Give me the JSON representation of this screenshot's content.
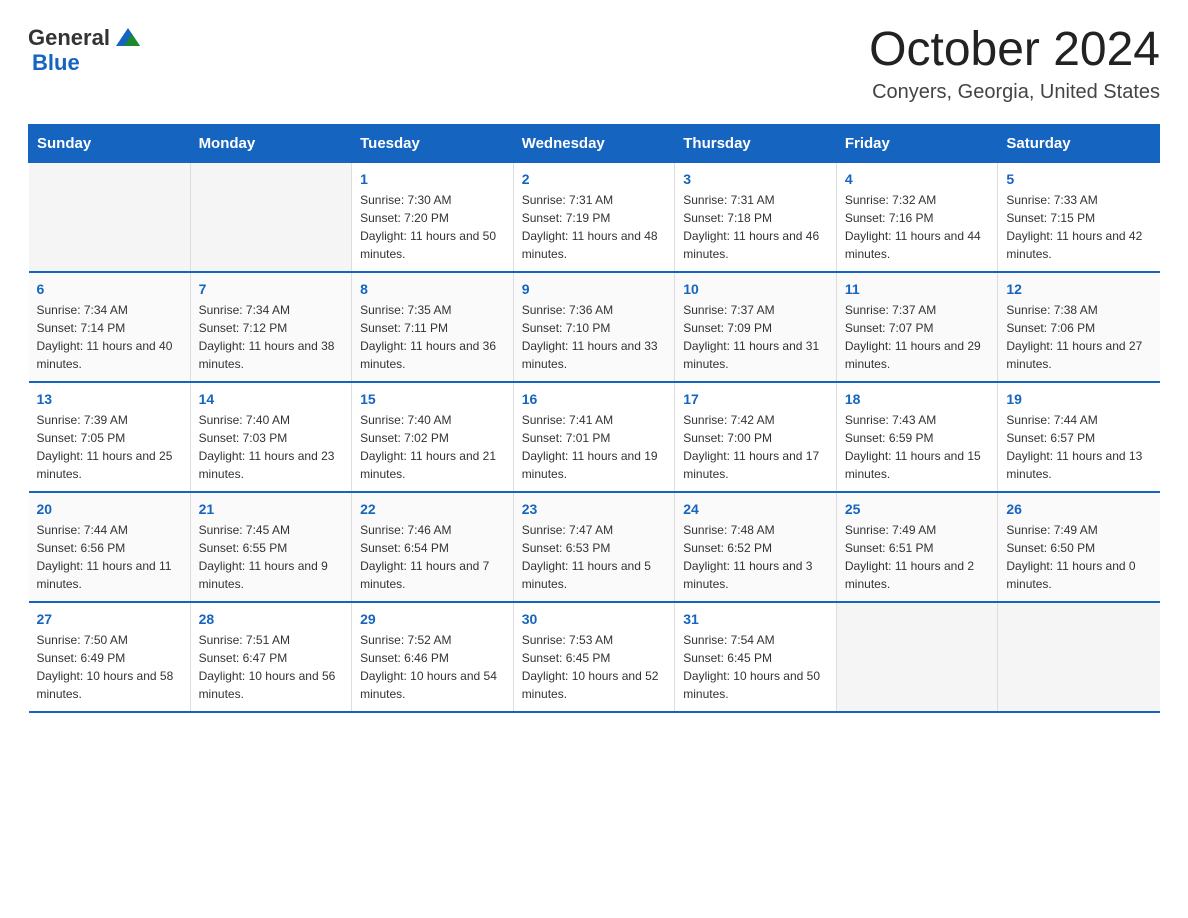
{
  "header": {
    "logo_general": "General",
    "logo_blue": "Blue",
    "title": "October 2024",
    "subtitle": "Conyers, Georgia, United States"
  },
  "days_of_week": [
    "Sunday",
    "Monday",
    "Tuesday",
    "Wednesday",
    "Thursday",
    "Friday",
    "Saturday"
  ],
  "weeks": [
    [
      {
        "day": "",
        "empty": true
      },
      {
        "day": "",
        "empty": true
      },
      {
        "day": "1",
        "sunrise": "7:30 AM",
        "sunset": "7:20 PM",
        "daylight": "11 hours and 50 minutes."
      },
      {
        "day": "2",
        "sunrise": "7:31 AM",
        "sunset": "7:19 PM",
        "daylight": "11 hours and 48 minutes."
      },
      {
        "day": "3",
        "sunrise": "7:31 AM",
        "sunset": "7:18 PM",
        "daylight": "11 hours and 46 minutes."
      },
      {
        "day": "4",
        "sunrise": "7:32 AM",
        "sunset": "7:16 PM",
        "daylight": "11 hours and 44 minutes."
      },
      {
        "day": "5",
        "sunrise": "7:33 AM",
        "sunset": "7:15 PM",
        "daylight": "11 hours and 42 minutes."
      }
    ],
    [
      {
        "day": "6",
        "sunrise": "7:34 AM",
        "sunset": "7:14 PM",
        "daylight": "11 hours and 40 minutes."
      },
      {
        "day": "7",
        "sunrise": "7:34 AM",
        "sunset": "7:12 PM",
        "daylight": "11 hours and 38 minutes."
      },
      {
        "day": "8",
        "sunrise": "7:35 AM",
        "sunset": "7:11 PM",
        "daylight": "11 hours and 36 minutes."
      },
      {
        "day": "9",
        "sunrise": "7:36 AM",
        "sunset": "7:10 PM",
        "daylight": "11 hours and 33 minutes."
      },
      {
        "day": "10",
        "sunrise": "7:37 AM",
        "sunset": "7:09 PM",
        "daylight": "11 hours and 31 minutes."
      },
      {
        "day": "11",
        "sunrise": "7:37 AM",
        "sunset": "7:07 PM",
        "daylight": "11 hours and 29 minutes."
      },
      {
        "day": "12",
        "sunrise": "7:38 AM",
        "sunset": "7:06 PM",
        "daylight": "11 hours and 27 minutes."
      }
    ],
    [
      {
        "day": "13",
        "sunrise": "7:39 AM",
        "sunset": "7:05 PM",
        "daylight": "11 hours and 25 minutes."
      },
      {
        "day": "14",
        "sunrise": "7:40 AM",
        "sunset": "7:03 PM",
        "daylight": "11 hours and 23 minutes."
      },
      {
        "day": "15",
        "sunrise": "7:40 AM",
        "sunset": "7:02 PM",
        "daylight": "11 hours and 21 minutes."
      },
      {
        "day": "16",
        "sunrise": "7:41 AM",
        "sunset": "7:01 PM",
        "daylight": "11 hours and 19 minutes."
      },
      {
        "day": "17",
        "sunrise": "7:42 AM",
        "sunset": "7:00 PM",
        "daylight": "11 hours and 17 minutes."
      },
      {
        "day": "18",
        "sunrise": "7:43 AM",
        "sunset": "6:59 PM",
        "daylight": "11 hours and 15 minutes."
      },
      {
        "day": "19",
        "sunrise": "7:44 AM",
        "sunset": "6:57 PM",
        "daylight": "11 hours and 13 minutes."
      }
    ],
    [
      {
        "day": "20",
        "sunrise": "7:44 AM",
        "sunset": "6:56 PM",
        "daylight": "11 hours and 11 minutes."
      },
      {
        "day": "21",
        "sunrise": "7:45 AM",
        "sunset": "6:55 PM",
        "daylight": "11 hours and 9 minutes."
      },
      {
        "day": "22",
        "sunrise": "7:46 AM",
        "sunset": "6:54 PM",
        "daylight": "11 hours and 7 minutes."
      },
      {
        "day": "23",
        "sunrise": "7:47 AM",
        "sunset": "6:53 PM",
        "daylight": "11 hours and 5 minutes."
      },
      {
        "day": "24",
        "sunrise": "7:48 AM",
        "sunset": "6:52 PM",
        "daylight": "11 hours and 3 minutes."
      },
      {
        "day": "25",
        "sunrise": "7:49 AM",
        "sunset": "6:51 PM",
        "daylight": "11 hours and 2 minutes."
      },
      {
        "day": "26",
        "sunrise": "7:49 AM",
        "sunset": "6:50 PM",
        "daylight": "11 hours and 0 minutes."
      }
    ],
    [
      {
        "day": "27",
        "sunrise": "7:50 AM",
        "sunset": "6:49 PM",
        "daylight": "10 hours and 58 minutes."
      },
      {
        "day": "28",
        "sunrise": "7:51 AM",
        "sunset": "6:47 PM",
        "daylight": "10 hours and 56 minutes."
      },
      {
        "day": "29",
        "sunrise": "7:52 AM",
        "sunset": "6:46 PM",
        "daylight": "10 hours and 54 minutes."
      },
      {
        "day": "30",
        "sunrise": "7:53 AM",
        "sunset": "6:45 PM",
        "daylight": "10 hours and 52 minutes."
      },
      {
        "day": "31",
        "sunrise": "7:54 AM",
        "sunset": "6:45 PM",
        "daylight": "10 hours and 50 minutes."
      },
      {
        "day": "",
        "empty": true
      },
      {
        "day": "",
        "empty": true
      }
    ]
  ]
}
